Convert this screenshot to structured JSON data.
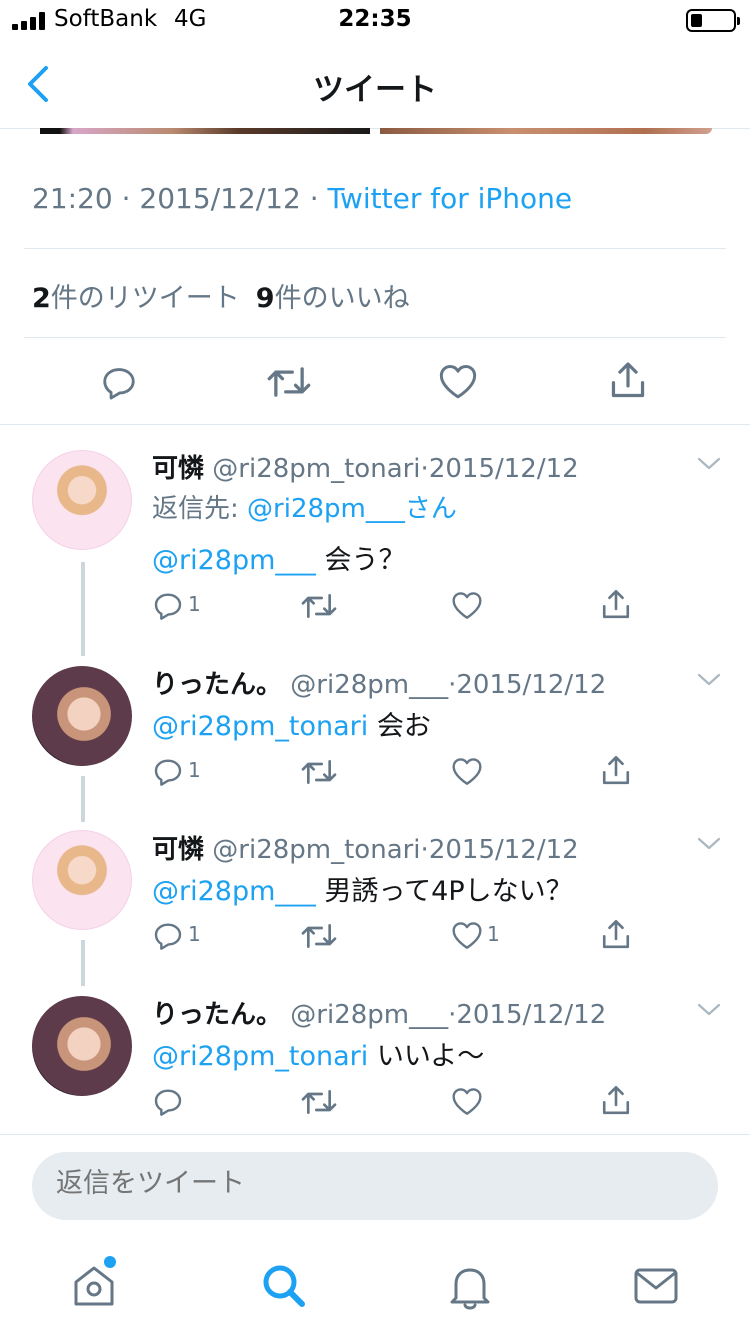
{
  "status_bar": {
    "carrier": "SoftBank",
    "network": "4G",
    "time": "22:35"
  },
  "nav": {
    "title": "ツイート"
  },
  "tweet": {
    "time": "21:20",
    "date": "2015/12/12",
    "client": "Twitter for iPhone",
    "retweet_count": "2",
    "retweet_label": "件のリツイート",
    "like_count": "9",
    "like_label": "件のいいね"
  },
  "replies": [
    {
      "name": "可憐",
      "handle": "@ri28pm_tonari",
      "date": "2015/12/12",
      "replying_prefix": "返信先: ",
      "replying_handle": "@ri28pm___",
      "replying_suffix": "さん",
      "mention": "@ri28pm___",
      "text": " 会う？",
      "reply_count": "1",
      "like_count": ""
    },
    {
      "name": "りったん。",
      "handle": "@ri28pm___",
      "date": "2015/12/12",
      "mention": "@ri28pm_tonari",
      "text": " 会お",
      "reply_count": "1",
      "like_count": ""
    },
    {
      "name": "可憐",
      "handle": "@ri28pm_tonari",
      "date": "2015/12/12",
      "mention": "@ri28pm___",
      "text": " 男誘って4Pしない？",
      "reply_count": "1",
      "like_count": "1"
    },
    {
      "name": "りったん。",
      "handle": "@ri28pm___",
      "date": "2015/12/12",
      "mention": "@ri28pm_tonari",
      "text": " いいよ〜",
      "reply_count": "",
      "like_count": ""
    }
  ],
  "composer": {
    "placeholder": "返信をツイート"
  },
  "tabs": [
    {
      "icon": "home-icon",
      "has_dot": true
    },
    {
      "icon": "search-icon",
      "active": true
    },
    {
      "icon": "bell-icon"
    },
    {
      "icon": "mail-icon"
    }
  ],
  "colors": {
    "accent": "#1da1f2",
    "secondary_text": "#657786",
    "divider": "#e1e8ed"
  }
}
